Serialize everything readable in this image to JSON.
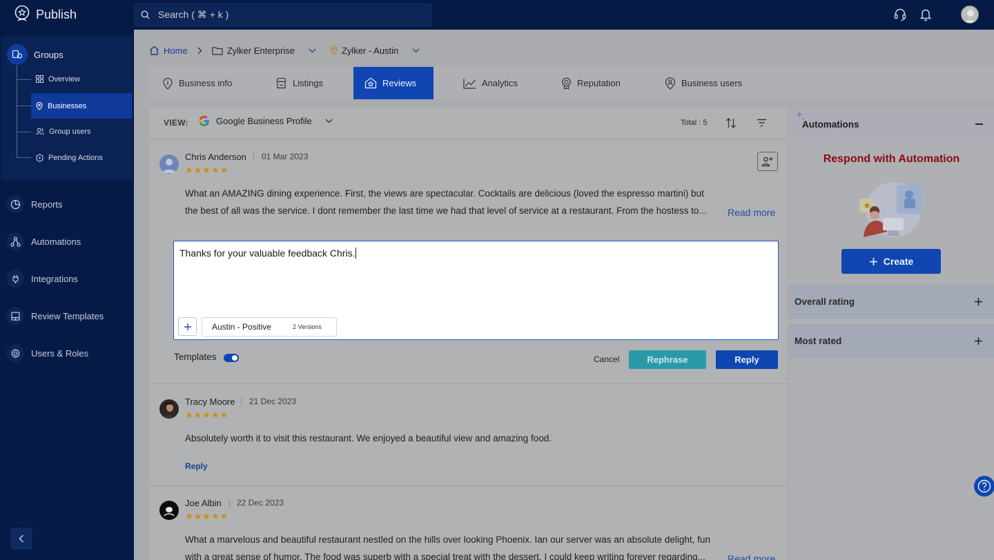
{
  "app": {
    "name": "Publish"
  },
  "search": {
    "placeholder": "Search ( ⌘ + k )"
  },
  "sidebar": {
    "groups": {
      "label": "Groups",
      "items": [
        {
          "label": "Overview",
          "icon": "grid-icon"
        },
        {
          "label": "Businesses",
          "icon": "location-icon",
          "active": true
        },
        {
          "label": "Group users",
          "icon": "users-icon"
        },
        {
          "label": "Pending Actions",
          "icon": "hexagon-icon"
        }
      ]
    },
    "nav": [
      {
        "label": "Reports",
        "icon": "pie-chart-icon"
      },
      {
        "label": "Automations",
        "icon": "flow-icon"
      },
      {
        "label": "Integrations",
        "icon": "plug-icon"
      },
      {
        "label": "Review Templates",
        "icon": "template-icon"
      },
      {
        "label": "Users & Roles",
        "icon": "gear-icon"
      }
    ]
  },
  "breadcrumb": {
    "home": "Home",
    "org": "Zylker Enterprise",
    "location": "Zylker - Austin"
  },
  "tabs": [
    {
      "label": "Business info",
      "icon": "info-icon"
    },
    {
      "label": "Listings",
      "icon": "store-icon"
    },
    {
      "label": "Reviews",
      "icon": "reviews-icon",
      "active": true
    },
    {
      "label": "Analytics",
      "icon": "line-chart-icon"
    },
    {
      "label": "Reputation",
      "icon": "badge-icon"
    },
    {
      "label": "Business users",
      "icon": "user-location-icon"
    }
  ],
  "view": {
    "label": "VIEW:",
    "source": "Google Business Profile",
    "total": "Total : 5"
  },
  "reviews": [
    {
      "name": "Chris Anderson",
      "date": "01 Mar 2023",
      "rating": 5,
      "line1": "What an AMAZING dining experience. First, the views are spectacular. Cocktails are delicious (loved the espresso martini) but",
      "line2": "the best of all was the service. I dont remember the last time we had that level of service at a restaurant. From the hostess to...",
      "read_more": "Read more"
    },
    {
      "name": "Tracy Moore",
      "date": "21 Dec 2023",
      "rating": 5,
      "line1": "Absolutely worth it to visit this restaurant. We enjoyed a beautiful view and amazing food.",
      "reply": "Reply"
    },
    {
      "name": "Joe Albin",
      "date": "22 Dec 2023",
      "rating": 5,
      "line1": "What a marvelous and beautiful restaurant nestled on the hills over looking Phoenix. Ian our server was an absolute delight, fun",
      "line2": "with a great sense of humor. The food was superb with a special treat with the dessert. I could keep writing forever regarding...",
      "read_more": "Read more"
    }
  ],
  "reply_editor": {
    "text": "Thanks for your valuable feedback Chris.",
    "template_name": "Austin - Positive",
    "template_versions": "2 Versions",
    "templates_label": "Templates",
    "cancel": "Cancel",
    "rephrase": "Rephrase",
    "reply": "Reply"
  },
  "right_panel": {
    "automations_title": "Automations",
    "automation_headline": "Respond with Automation",
    "create": "Create",
    "overall_rating": "Overall rating",
    "most_rated": "Most rated"
  },
  "colors": {
    "accent": "#0f46b1",
    "sidebar": "#051a45",
    "star": "#c98d12",
    "headline": "#8a0a14"
  }
}
